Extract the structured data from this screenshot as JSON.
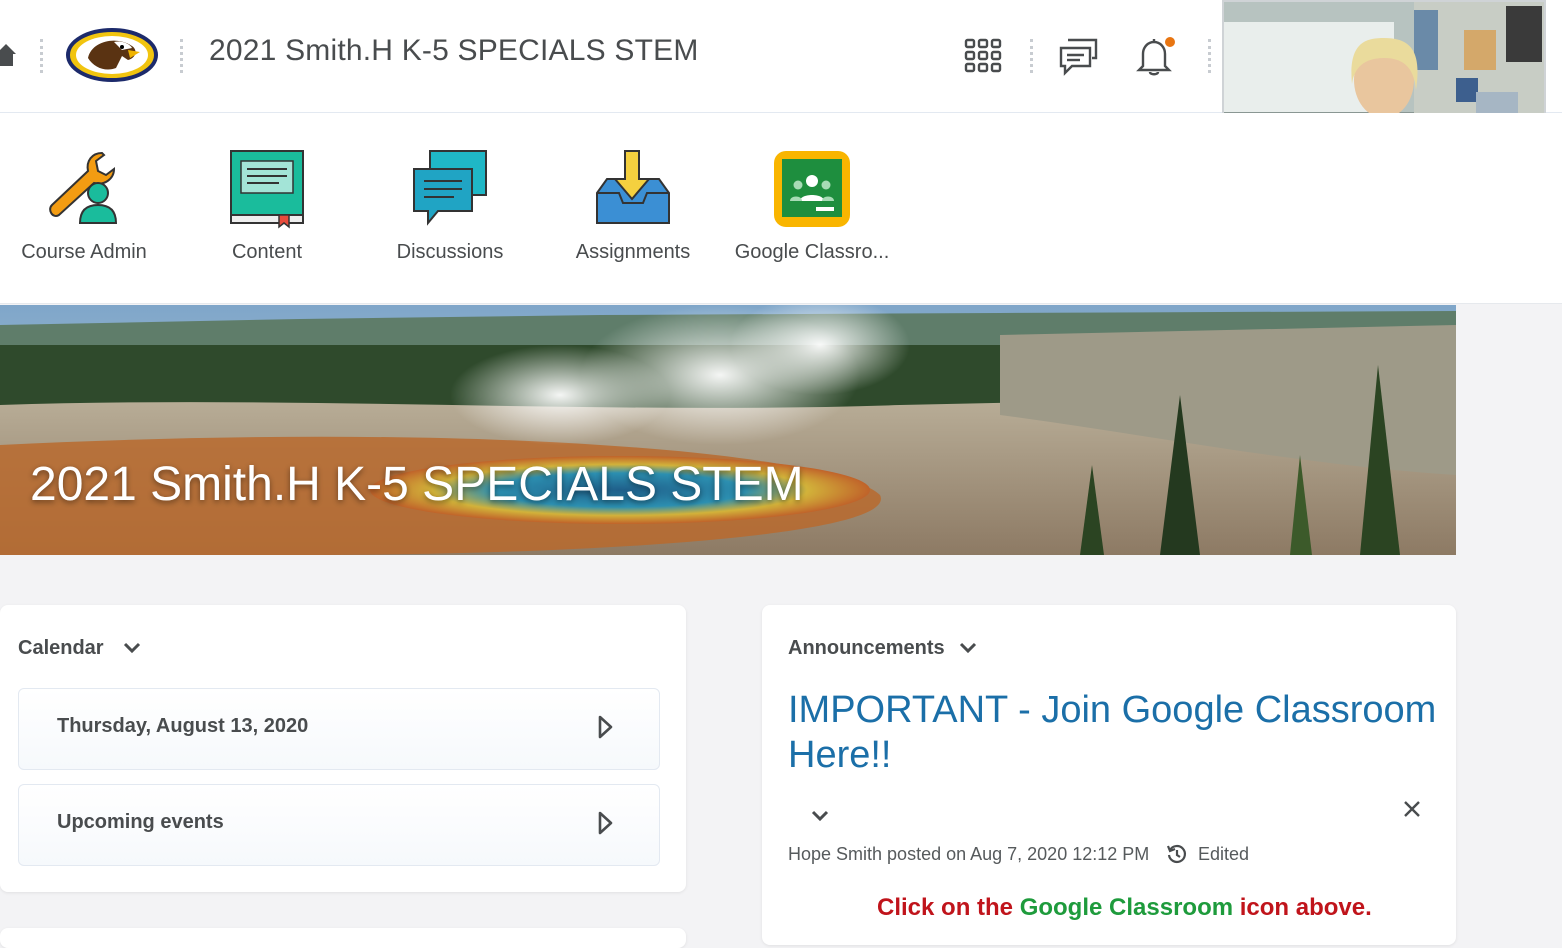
{
  "header": {
    "course_title": "2021 Smith.H K-5 SPECIALS STEM"
  },
  "nav": {
    "items": [
      {
        "label": "Course Admin"
      },
      {
        "label": "Content"
      },
      {
        "label": "Discussions"
      },
      {
        "label": "Assignments"
      },
      {
        "label": "Google Classro..."
      }
    ]
  },
  "banner": {
    "title": "2021 Smith.H K-5 SPECIALS STEM"
  },
  "calendar": {
    "title": "Calendar",
    "rows": [
      {
        "label": "Thursday, August 13, 2020"
      },
      {
        "label": "Upcoming events"
      }
    ]
  },
  "announcements": {
    "title": "Announcements",
    "item_title": "IMPORTANT - Join Google Classroom Here!!",
    "meta": "Hope Smith posted on Aug 7, 2020 12:12 PM",
    "edited_label": "Edited",
    "body": {
      "part1": "Click on the ",
      "part2": "Google Classroom",
      "part3": " icon above."
    }
  },
  "colors": {
    "accent_link": "#1b6fa8",
    "notification_dot": "#e87511",
    "body_red": "#c0141b",
    "body_green": "#1e9b3c"
  },
  "icons": [
    "home-icon",
    "eagle-logo",
    "app-grid-icon",
    "chat-icon",
    "bell-icon",
    "chevron-down-icon",
    "triangle-right-icon",
    "close-icon",
    "history-icon"
  ]
}
